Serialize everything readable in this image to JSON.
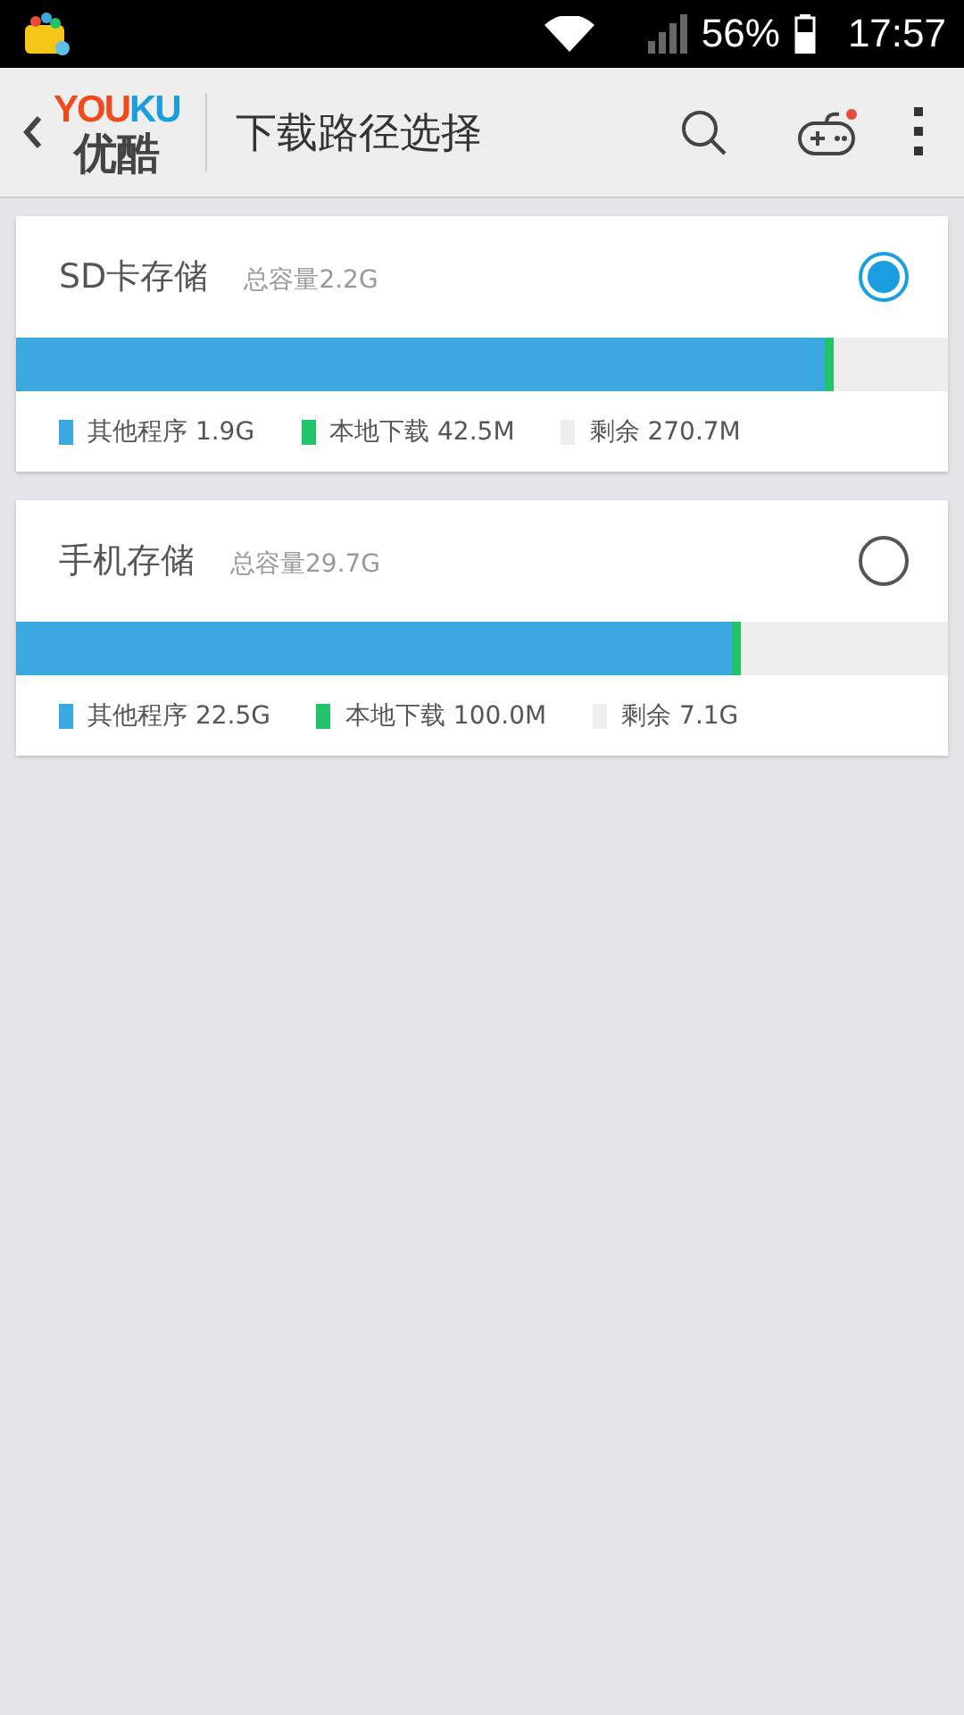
{
  "status_bar": {
    "battery": "56%",
    "time": "17:57"
  },
  "app_bar": {
    "logo_top": "YOU",
    "logo_top_accent": "KU",
    "logo_bottom": "优酷",
    "title": "下载路径选择"
  },
  "storages": [
    {
      "name": "SD卡存储",
      "capacity": "总容量2.2G",
      "selected": true,
      "level": 0.877,
      "segments": [
        {
          "label": "其他程序",
          "value": "1.9G",
          "color": "#3ba8e0"
        },
        {
          "label": "本地下载",
          "value": "42.5M",
          "color": "#22c46a"
        },
        {
          "label": "剩余",
          "value": "270.7M",
          "color": "#eeeeee"
        }
      ]
    },
    {
      "name": "手机存储",
      "capacity": "总容量29.7G",
      "selected": false,
      "level": 0.777,
      "segments": [
        {
          "label": "其他程序",
          "value": "22.5G",
          "color": "#3ba8e0"
        },
        {
          "label": "本地下载",
          "value": "100.0M",
          "color": "#22c46a"
        },
        {
          "label": "剩余",
          "value": "7.1G",
          "color": "#eeeeee"
        }
      ]
    }
  ]
}
